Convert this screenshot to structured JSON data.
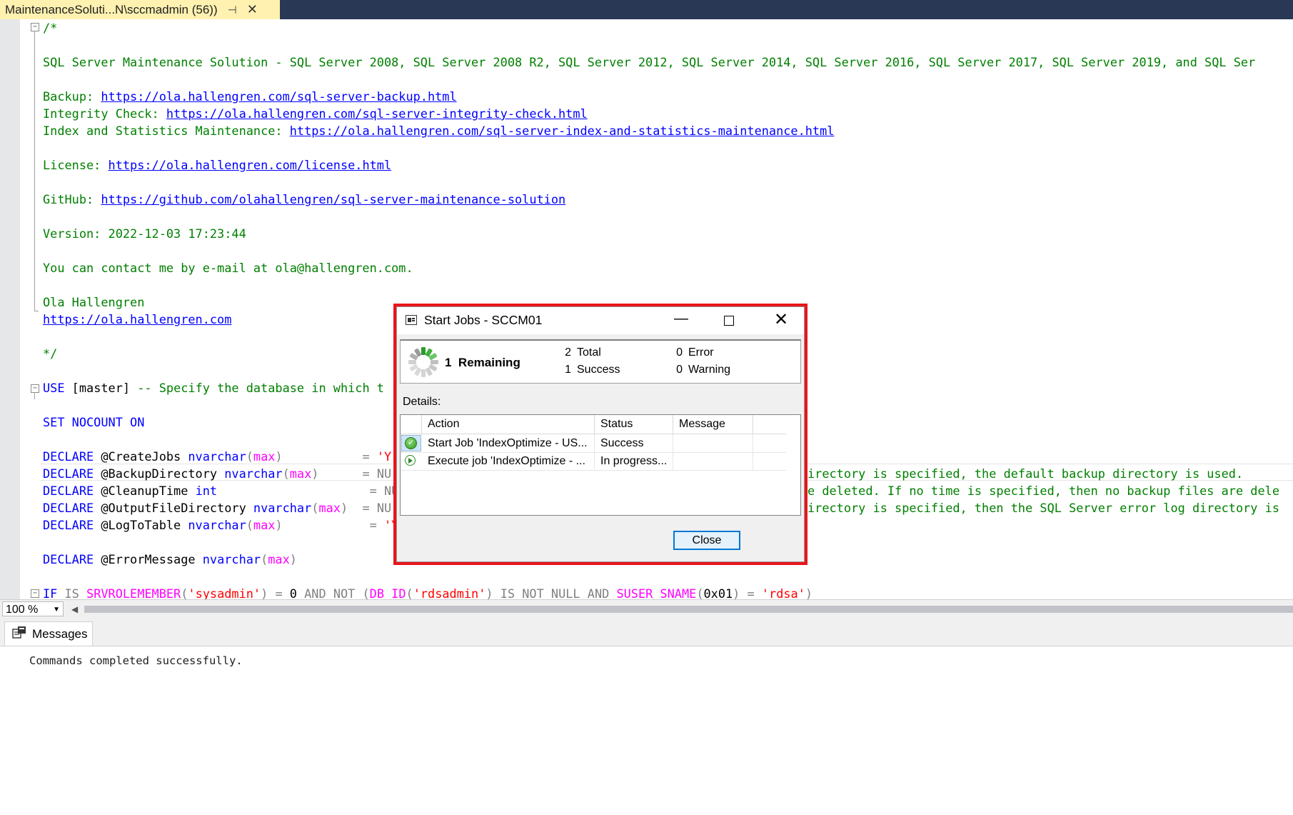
{
  "document_tab": {
    "title": "MaintenanceSoluti...N\\sccmadmin (56))",
    "pin_icon": "pin-icon",
    "close_icon": "close-icon"
  },
  "editor": {
    "code": {
      "l1": "/*",
      "l3": "SQL Server Maintenance Solution - SQL Server 2008, SQL Server 2008 R2, SQL Server 2012, SQL Server 2014, SQL Server 2016, SQL Server 2017, SQL Server 2019, and SQL Ser",
      "backup_label": "Backup: ",
      "backup_url": "https://ola.hallengren.com/sql-server-backup.html",
      "integrity_label": "Integrity Check: ",
      "integrity_url": "https://ola.hallengren.com/sql-server-integrity-check.html",
      "index_label": "Index and Statistics Maintenance: ",
      "index_url": "https://ola.hallengren.com/sql-server-index-and-statistics-maintenance.html",
      "license_label": "License: ",
      "license_url": "https://ola.hallengren.com/license.html",
      "github_label": "GitHub: ",
      "github_url": "https://github.com/olahallengren/sql-server-maintenance-solution",
      "version": "Version: 2022-12-03 17:23:44",
      "contact": "You can contact me by e-mail at ola@hallengren.com.",
      "author": "Ola Hallengren",
      "author_url": "https://ola.hallengren.com",
      "comment_end": "*/",
      "use_kw": "USE",
      "use_db": " [master] ",
      "use_cmt": "-- Specify the database in which t",
      "set_nocount": "SET NOCOUNT ON",
      "declare": "DECLARE",
      "d1_var": " @CreateJobs ",
      "d1_type": "nvarchar",
      "d1_max": "max",
      "d1_eq": "           = ",
      "d1_val": "'Y",
      "d2_var": " @BackupDirectory ",
      "d2_type": "nvarchar",
      "d2_max": "max",
      "d2_eq": "      = ",
      "d2_val": "NU",
      "d2_cmt": "irectory is specified, the default backup directory is used.",
      "d3_var": " @CleanupTime ",
      "d3_type": "int",
      "d3_eq": "                     = ",
      "d3_val": "NU",
      "d3_cmt": "e deleted. If no time is specified, then no backup files are dele",
      "d4_var": " @OutputFileDirectory ",
      "d4_type": "nvarchar",
      "d4_max": "max",
      "d4_eq": "  = ",
      "d4_val": "NU",
      "d4_cmt": "irectory is specified, then the SQL Server error log directory is",
      "d5_var": " @LogToTable ",
      "d5_type": "nvarchar",
      "d5_max": "max",
      "d5_eq": "            = ",
      "d5_val": "'Y",
      "d6_var": " @ErrorMessage ",
      "d6_type": "nvarchar",
      "d6_max": "max",
      "if_kw": "IF",
      "if_is": " IS ",
      "if_fn": "SRVROLEMEMBER",
      "if_arg": "'sysadmin'",
      "if_eq": " = ",
      "if_zero": "0",
      "if_and": " AND NOT ",
      "if_dbid": "DB_ID",
      "if_rds": "'rdsadmin'",
      "if_notnull": " IS NOT NULL AND ",
      "if_suser": "SUSER_SNAME",
      "if_hex": "0x01",
      "if_eq2": " = ",
      "if_rdsa": "'rdsa'"
    }
  },
  "zoom": {
    "value": "100 %"
  },
  "results": {
    "tab_label": "Messages",
    "tab_icon": "messages-icon",
    "text": "Commands completed successfully."
  },
  "dialog": {
    "title": "Start Jobs - SCCM01",
    "remaining_count": "1",
    "remaining_label": "Remaining",
    "total_count": "2",
    "total_label": "Total",
    "success_count": "1",
    "success_label": "Success",
    "error_count": "0",
    "error_label": "Error",
    "warning_count": "0",
    "warning_label": "Warning",
    "details_label": "Details:",
    "columns": [
      "Action",
      "Status",
      "Message"
    ],
    "rows": [
      {
        "action": "Start Job 'IndexOptimize - US...",
        "status": "Success",
        "message": "",
        "icon": "success-check-icon"
      },
      {
        "action": "Execute job 'IndexOptimize - ...",
        "status": "In progress...",
        "message": "",
        "icon": "in-progress-icon"
      }
    ],
    "close_label": "Close",
    "colors": {
      "highlight": "#e8141c",
      "button_border": "#0078d7"
    }
  }
}
